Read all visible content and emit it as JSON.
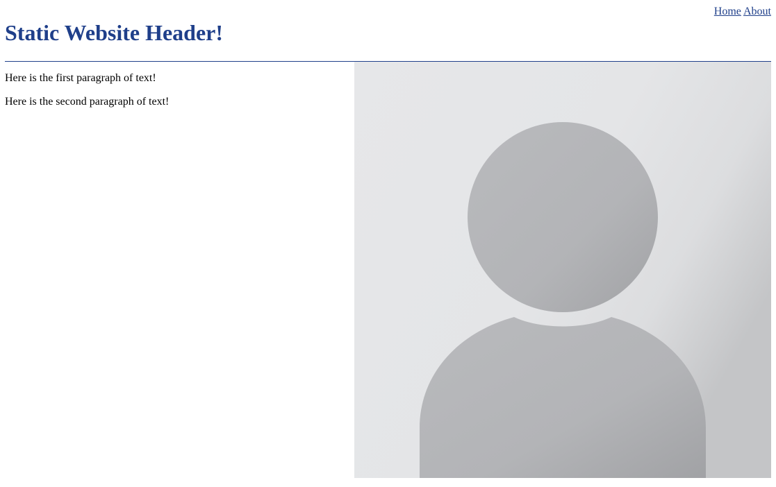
{
  "nav": {
    "links": [
      "Home",
      "About"
    ]
  },
  "header": {
    "title": "Static Website Header!"
  },
  "main": {
    "paragraphs": [
      "Here is the first paragraph of text!",
      "Here is the second paragraph of text!"
    ]
  },
  "avatar": {
    "icon": "user-silhouette-icon",
    "colors": {
      "background_light": "#e7e8ea",
      "background_dark": "#c9cacc",
      "figure": "#b8b9bc",
      "figure_dark": "#a4a5a8"
    }
  },
  "colors": {
    "accent": "#1f3f8a"
  }
}
